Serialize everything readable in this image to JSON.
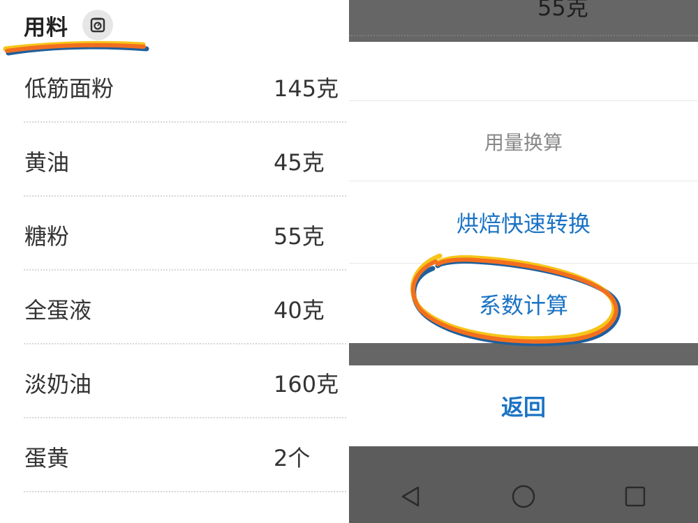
{
  "left_panel": {
    "section_title": "用料",
    "scale_icon": "scale-icon",
    "ingredients": [
      {
        "name": "低筋面粉",
        "amount": "145克"
      },
      {
        "name": "黄油",
        "amount": "45克"
      },
      {
        "name": "糖粉",
        "amount": "55克"
      },
      {
        "name": "全蛋液",
        "amount": "40克"
      },
      {
        "name": "淡奶油",
        "amount": "160克"
      },
      {
        "name": "蛋黄",
        "amount": "2个"
      }
    ]
  },
  "right_panel": {
    "background_partial_text": "55克",
    "sheet": {
      "header": "用量换算",
      "options": [
        {
          "label": "烘焙快速转换"
        },
        {
          "label": "系数计算"
        }
      ]
    },
    "back_label": "返回",
    "nav_icons": [
      "back-triangle-icon",
      "home-circle-icon",
      "recents-square-icon"
    ]
  },
  "colors": {
    "link_blue": "#1a73c4",
    "overlay_gray": "#666666",
    "highlight_orange": "#f36f1f",
    "highlight_yellow": "#f5c518",
    "highlight_blue": "#1f5f9c"
  }
}
